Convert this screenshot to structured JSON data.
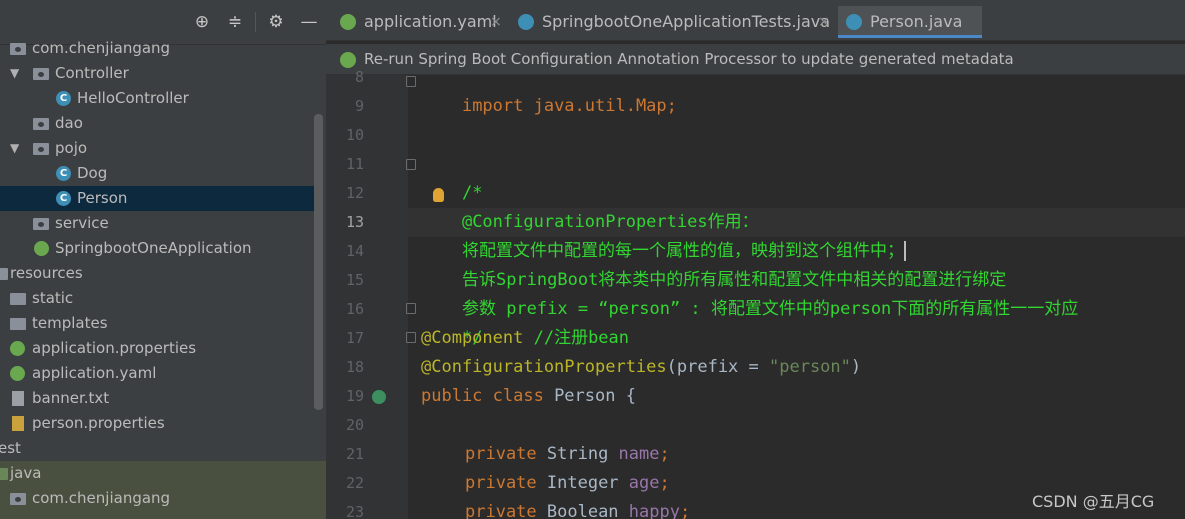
{
  "panel_toolbar": {
    "icons": [
      "target-icon",
      "collapse-icon",
      "gear-icon",
      "minimize-icon"
    ]
  },
  "tree": [
    {
      "label": "com.chenjiangang",
      "kind": "package"
    },
    {
      "label": "Controller",
      "kind": "package"
    },
    {
      "label": "HelloController",
      "kind": "class"
    },
    {
      "label": "dao",
      "kind": "package"
    },
    {
      "label": "pojo",
      "kind": "package"
    },
    {
      "label": "Dog",
      "kind": "class"
    },
    {
      "label": "Person",
      "kind": "class",
      "selected": true
    },
    {
      "label": "service",
      "kind": "package"
    },
    {
      "label": "SpringbootOneApplication",
      "kind": "spring-class"
    },
    {
      "label": "resources",
      "kind": "folder"
    },
    {
      "label": "static",
      "kind": "folder"
    },
    {
      "label": "templates",
      "kind": "folder"
    },
    {
      "label": "application.properties",
      "kind": "spring-file"
    },
    {
      "label": "application.yaml",
      "kind": "spring-file"
    },
    {
      "label": "banner.txt",
      "kind": "text-file"
    },
    {
      "label": "person.properties",
      "kind": "properties-file"
    },
    {
      "label": "est",
      "kind": "folder"
    },
    {
      "label": "java",
      "kind": "folder"
    },
    {
      "label": "com.chenjiangang",
      "kind": "package"
    }
  ],
  "tabs": [
    {
      "label": "application.yaml",
      "close": "×"
    },
    {
      "label": "SpringbootOneApplicationTests.java",
      "close": "×"
    },
    {
      "label": "Person.java",
      "active": true
    }
  ],
  "banner": {
    "text": "Re-run Spring Boot Configuration Annotation Processor to update generated metadata"
  },
  "line_numbers": [
    "8",
    "9",
    "10",
    "11",
    "12",
    "13",
    "14",
    "15",
    "16",
    "17",
    "18",
    "19",
    "20",
    "21",
    "22",
    "23"
  ],
  "current_line": "13",
  "code": {
    "l8": "import java.util.Map;",
    "l11": "/*",
    "l12": "@ConfigurationProperties作用：",
    "l13": "将配置文件中配置的每一个属性的值，映射到这个组件中；",
    "l14": "告诉SpringBoot将本类中的所有属性和配置文件中相关的配置进行绑定",
    "l15": "参数 prefix = “person” : 将配置文件中的person下面的所有属性一一对应",
    "l16": "*/",
    "l17_ann": "@Component",
    "l17_comment": " //注册bean",
    "l18_ann": "@ConfigurationProperties",
    "l18_open": "(prefix = ",
    "l18_str": "\"person\"",
    "l18_close": ")",
    "l19_kw": "public class ",
    "l19_name": "Person {",
    "l21_kw": "private ",
    "l21_type": "String ",
    "l21_field": "name",
    "l22_kw": "private ",
    "l22_type": "Integer ",
    "l22_field": "age",
    "l23_kw": "private ",
    "l23_type": "Boolean ",
    "l23_field": "happy",
    "semi": ";"
  },
  "watermark": "CSDN @五月CG",
  "colors": {
    "background": "#2b2b2b",
    "comment_green": "#32d532",
    "keyword": "#cc7832",
    "annotation": "#bbb529",
    "selection": "#0d293e"
  }
}
